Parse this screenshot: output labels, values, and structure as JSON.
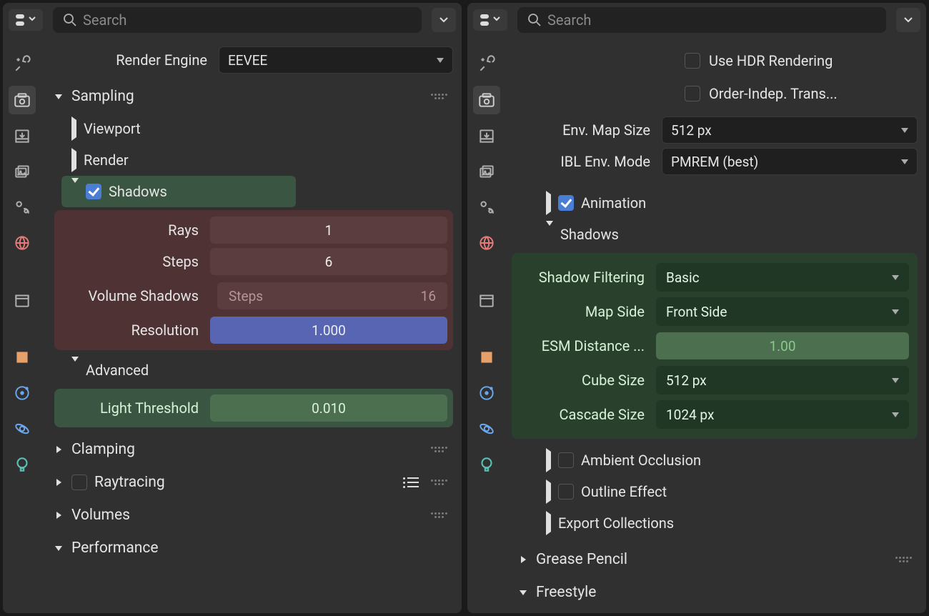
{
  "left": {
    "search_placeholder": "Search",
    "engine_label": "Render Engine",
    "engine_value": "EEVEE",
    "sampling_label": "Sampling",
    "viewport_label": "Viewport",
    "render_label": "Render",
    "shadows_label": "Shadows",
    "rays_label": "Rays",
    "rays_value": "1",
    "steps_label": "Steps",
    "steps_value": "6",
    "vol_shadows_label": "Volume Shadows",
    "vol_steps_label": "Steps",
    "vol_steps_value": "16",
    "resolution_label": "Resolution",
    "resolution_value": "1.000",
    "advanced_label": "Advanced",
    "light_thresh_label": "Light Threshold",
    "light_thresh_value": "0.010",
    "clamping_label": "Clamping",
    "raytracing_label": "Raytracing",
    "volumes_label": "Volumes",
    "performance_label": "Performance"
  },
  "right": {
    "search_placeholder": "Search",
    "hdr_label": "Use HDR Rendering",
    "oit_label": "Order-Indep. Trans...",
    "env_size_label": "Env. Map Size",
    "env_size_value": "512 px",
    "ibl_label": "IBL Env. Mode",
    "ibl_value": "PMREM (best)",
    "animation_label": "Animation",
    "shadows_label": "Shadows",
    "filtering_label": "Shadow Filtering",
    "filtering_value": "Basic",
    "mapside_label": "Map Side",
    "mapside_value": "Front Side",
    "esm_label": "ESM Distance ...",
    "esm_value": "1.00",
    "cube_label": "Cube Size",
    "cube_value": "512 px",
    "cascade_label": "Cascade Size",
    "cascade_value": "1024 px",
    "ao_label": "Ambient Occlusion",
    "outline_label": "Outline Effect",
    "export_label": "Export Collections",
    "gp_label": "Grease Pencil",
    "freestyle_label": "Freestyle"
  }
}
